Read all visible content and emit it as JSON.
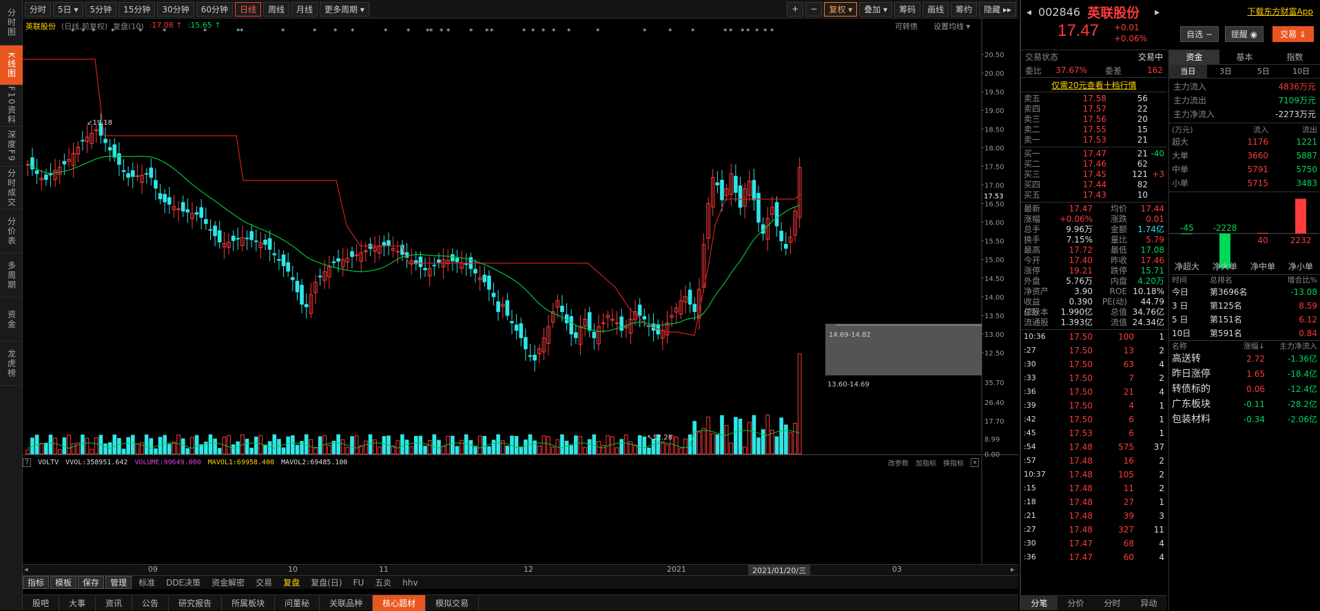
{
  "leftnav": [
    "分时图",
    "K线图",
    "F10资料",
    "深度F9",
    "分时成交",
    "分价表",
    "多周期",
    "资金",
    "龙虎榜"
  ],
  "toolbar": {
    "periods": [
      "分时",
      "5日 ▾",
      "5分钟",
      "15分钟",
      "30分钟",
      "60分钟",
      "日线",
      "周线",
      "月线",
      "更多周期 ▾"
    ],
    "active_period": "日线",
    "right": [
      "+",
      "−",
      "复权 ▾",
      "叠加 ▾",
      "筹码",
      "画线",
      "筹约",
      "隐藏 ▸▸"
    ]
  },
  "chart_header": {
    "name": "英联股份",
    "mode": "(日线,前复权)",
    "fupan": "复盘(10)",
    "val1": "17.08",
    "val2": "15.65",
    "right1": "可转债",
    "right2": "设置均线 ▾"
  },
  "price_axis": [
    "20.50",
    "20.00",
    "19.50",
    "19.00",
    "18.50",
    "18.00",
    "17.50",
    "17.00",
    "16.50",
    "16.00",
    "15.50",
    "15.00",
    "14.50",
    "14.00",
    "13.50",
    "13.00",
    "12.50"
  ],
  "last_price_label": "17.53",
  "annotations": {
    "high": "19.18",
    "low": "12.28",
    "zone_top": "14.69-14.82",
    "zone_bottom": "13.60-14.69"
  },
  "volume_header": {
    "name": "VOLTV",
    "vvol": "VVOL:358951.642",
    "volume": "VOLUME:99649.000",
    "mavol1": "MAVOL1:69958.400",
    "mavol2": "MAVOL2:69485.100",
    "right": [
      "改参数",
      "加指标",
      "换指标"
    ]
  },
  "volume_axis": [
    "35.70",
    "26.40",
    "17.70",
    "8.99",
    "0.00"
  ],
  "date_axis": [
    "09",
    "10",
    "11",
    "12",
    "2021",
    "03"
  ],
  "date_cursor": "2021/01/20/三",
  "bottom_indicators": [
    "指标",
    "模板",
    "保存",
    "管理",
    "标准",
    "DDE决策",
    "资金解密",
    "交易",
    "复盘",
    "复盘(日)",
    "FU",
    "五炎",
    "hhv"
  ],
  "bottom_tabs": [
    "股吧",
    "大事",
    "资讯",
    "公告",
    "研究报告",
    "所属板块",
    "问董秘",
    "关联品种",
    "核心题材",
    "模拟交易"
  ],
  "active_tab": "核心题材",
  "stock": {
    "code": "002846",
    "name": "英联股份",
    "download": "下载东方财富App",
    "price": "17.47",
    "change": "+0.01",
    "change_pct": "+0.06%",
    "btn_watch": "自选 −",
    "btn_alert": "提醒 ◉",
    "btn_trade": "交易 ⇓"
  },
  "status": {
    "label": "交易状态",
    "value": "交易中",
    "weibi_label": "委比",
    "weibi": "37.67%",
    "weicha_label": "委差",
    "weicha": "162",
    "promo": "仅需20元查看十档行情"
  },
  "sells": [
    [
      "卖五",
      "17.58",
      "56"
    ],
    [
      "卖四",
      "17.57",
      "22"
    ],
    [
      "卖三",
      "17.56",
      "20"
    ],
    [
      "卖二",
      "17.55",
      "15"
    ],
    [
      "卖一",
      "17.53",
      "21"
    ]
  ],
  "buys": [
    [
      "买一",
      "17.47",
      "21",
      "-40"
    ],
    [
      "买二",
      "17.46",
      "62",
      ""
    ],
    [
      "买三",
      "17.45",
      "121",
      "+3"
    ],
    [
      "买四",
      "17.44",
      "82",
      ""
    ],
    [
      "买五",
      "17.43",
      "10",
      ""
    ]
  ],
  "quote": [
    [
      "最新",
      "17.47",
      "均价",
      "17.44"
    ],
    [
      "涨幅",
      "+0.06%",
      "涨跌",
      "0.01"
    ],
    [
      "总手",
      "9.96万",
      "金额",
      "1.74亿"
    ],
    [
      "换手",
      "7.15%",
      "量比",
      "5.79"
    ],
    [
      "最高",
      "17.72",
      "最低",
      "17.08"
    ],
    [
      "今开",
      "17.40",
      "昨收",
      "17.46"
    ],
    [
      "涨停",
      "19.21",
      "跌停",
      "15.71"
    ],
    [
      "外盘",
      "5.76万",
      "内盘",
      "4.20万"
    ],
    [
      "净资产",
      "3.90",
      "ROE",
      "10.18%"
    ],
    [
      "收益(四)",
      "0.390",
      "PE(动)",
      "44.79"
    ],
    [
      "总股本",
      "1.990亿",
      "总值",
      "34.76亿"
    ],
    [
      "流通股",
      "1.393亿",
      "流值",
      "24.34亿"
    ]
  ],
  "ticks": [
    [
      "10:36",
      "17.50",
      "100",
      "1"
    ],
    [
      ":27",
      "17.50",
      "13",
      "2"
    ],
    [
      ":30",
      "17.50",
      "63",
      "4"
    ],
    [
      ":33",
      "17.50",
      "7",
      "2"
    ],
    [
      ":36",
      "17.50",
      "21",
      "4"
    ],
    [
      ":39",
      "17.50",
      "4",
      "1"
    ],
    [
      ":42",
      "17.50",
      "6",
      "1"
    ],
    [
      ":45",
      "17.53",
      "6",
      "1"
    ],
    [
      ":54",
      "17.48",
      "575",
      "37"
    ],
    [
      ":57",
      "17.48",
      "16",
      "2"
    ],
    [
      "10:37",
      "17.48",
      "105",
      "2"
    ],
    [
      ":15",
      "17.48",
      "11",
      "2"
    ],
    [
      ":18",
      "17.48",
      "27",
      "1"
    ],
    [
      ":21",
      "17.48",
      "39",
      "3"
    ],
    [
      ":27",
      "17.48",
      "327",
      "11"
    ],
    [
      ":30",
      "17.47",
      "68",
      "4"
    ],
    [
      ":36",
      "17.47",
      "60",
      "4"
    ]
  ],
  "tick_tabs": [
    "分笔",
    "分价",
    "分时",
    "异动"
  ],
  "fund": {
    "tabs": [
      "资金",
      "基本",
      "指数"
    ],
    "subtabs": [
      "当日",
      "3日",
      "5日",
      "10日"
    ],
    "inflow_label": "主力流入",
    "inflow": "4836万元",
    "outflow_label": "主力流出",
    "outflow": "7109万元",
    "net_label": "主力净流入",
    "net": "-2273万元",
    "table_head": [
      "(万元)",
      "流入",
      "流出"
    ],
    "rows": [
      [
        "超大",
        "1176",
        "1221"
      ],
      [
        "大单",
        "3660",
        "5887"
      ],
      [
        "中单",
        "5791",
        "5750"
      ],
      [
        "小单",
        "5715",
        "3483"
      ]
    ],
    "bars": [
      {
        "label": "净超大",
        "value": -45
      },
      {
        "label": "净大单",
        "value": -2228
      },
      {
        "label": "净中单",
        "value": 40
      },
      {
        "label": "净小单",
        "value": 2232
      }
    ]
  },
  "rank": {
    "head": [
      "时间",
      "总排名",
      "增合比%"
    ],
    "rows": [
      [
        "今日",
        "第3696名",
        "-13.08"
      ],
      [
        "3 日",
        "第125名",
        "8.59"
      ],
      [
        "5 日",
        "第151名",
        "6.12"
      ],
      [
        "10日",
        "第591名",
        "0.84"
      ]
    ]
  },
  "concepts": {
    "head": [
      "名称",
      "涨幅↓",
      "主力净流入"
    ],
    "rows": [
      [
        "高送转",
        "2.72",
        "-1.36亿"
      ],
      [
        "昨日涨停",
        "1.65",
        "-18.4亿"
      ],
      [
        "转债标的",
        "0.06",
        "-12.4亿"
      ],
      [
        "广东板块",
        "-0.11",
        "-28.2亿"
      ],
      [
        "包装材料",
        "-0.34",
        "-2.06亿"
      ]
    ]
  },
  "colors": {
    "up": "#ff3b3b",
    "down": "#2ee6e6",
    "ma": "#00c83c",
    "stop": "#d42020",
    "accent": "#e8561f"
  }
}
